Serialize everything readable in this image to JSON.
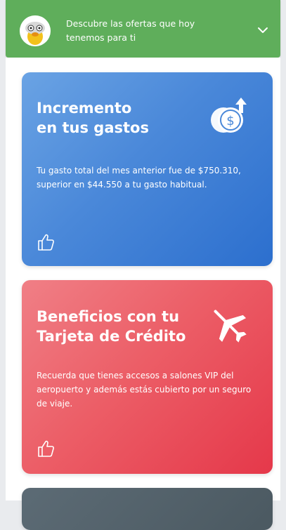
{
  "banner": {
    "text": "Descubre las ofertas que hoy tenemos para ti"
  },
  "cards": [
    {
      "title_line1": "Incremento",
      "title_line2": "en tus gastos",
      "body": "Tu gasto total del mes anterior fue de $750.310, superior en $44.550 a tu gasto habitual.",
      "icon": "coins-up-arrow-icon",
      "action_icon": "thumbs-up-icon"
    },
    {
      "title_line1": "Beneficios con tu",
      "title_line2": "Tarjeta de Crédito",
      "body": "Recuerda que tienes accesos a salones VIP del aeropuerto y además estás cubierto por un seguro de viaje.",
      "icon": "airplane-icon",
      "action_icon": "thumbs-up-icon"
    }
  ],
  "colors": {
    "banner": "#5fae5b",
    "card_blue": "#4a88d9",
    "card_red": "#ec5e67",
    "card_dark": "#55626b"
  }
}
